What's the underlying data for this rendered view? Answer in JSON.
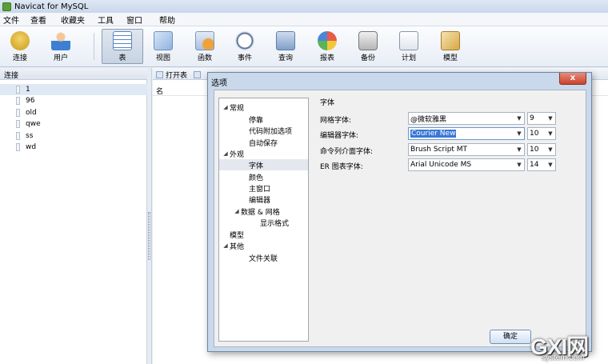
{
  "window": {
    "title": "Navicat for MySQL"
  },
  "menubar": [
    "文件",
    "查看",
    "收藏夹",
    "工具",
    "窗口",
    "帮助"
  ],
  "toolbar": [
    {
      "label": "连接",
      "icon": "connection-icon"
    },
    {
      "label": "用户",
      "icon": "user-icon"
    },
    {
      "label": "表",
      "icon": "table-icon"
    },
    {
      "label": "视图",
      "icon": "view-icon"
    },
    {
      "label": "函数",
      "icon": "function-icon"
    },
    {
      "label": "事件",
      "icon": "event-icon"
    },
    {
      "label": "查询",
      "icon": "query-icon"
    },
    {
      "label": "报表",
      "icon": "report-icon"
    },
    {
      "label": "备份",
      "icon": "backup-icon"
    },
    {
      "label": "计划",
      "icon": "schedule-icon"
    },
    {
      "label": "模型",
      "icon": "model-icon"
    }
  ],
  "left": {
    "header": "连接",
    "databases": [
      "1",
      "96",
      "old",
      "qwe",
      "ss",
      "wd"
    ],
    "selected": "1"
  },
  "object_toolbar": {
    "open_table": "打开表"
  },
  "object_list": {
    "column_name": "名"
  },
  "dialog": {
    "title": "选项",
    "close": "x",
    "tree": [
      {
        "label": "常规",
        "level": 0,
        "expanded": true
      },
      {
        "label": "停靠",
        "level": 1
      },
      {
        "label": "代码附加选项",
        "level": 1
      },
      {
        "label": "自动保存",
        "level": 1
      },
      {
        "label": "外观",
        "level": 0,
        "expanded": true
      },
      {
        "label": "字体",
        "level": 1,
        "selected": true
      },
      {
        "label": "颜色",
        "level": 1
      },
      {
        "label": "主窗口",
        "level": 1
      },
      {
        "label": "编辑器",
        "level": 1
      },
      {
        "label": "数据 & 网格",
        "level": 1,
        "expanded": true
      },
      {
        "label": "显示格式",
        "level": 2
      },
      {
        "label": "模型",
        "level": 0
      },
      {
        "label": "其他",
        "level": 0,
        "expanded": true
      },
      {
        "label": "文件关联",
        "level": 1
      }
    ],
    "section_title": "字体",
    "font_rows": [
      {
        "label": "网格字体:",
        "font": "@微软雅黑",
        "size": "9"
      },
      {
        "label": "编辑器字体:",
        "font": "Courier New",
        "size": "10"
      },
      {
        "label": "命令列介面字体:",
        "font": "Brush Script MT",
        "size": "10"
      },
      {
        "label": "ER 图表字体:",
        "font": "Arial Unicode MS",
        "size": "14"
      }
    ],
    "ok": "确定"
  },
  "watermark": {
    "main": "GXI网",
    "sub": "system.com"
  },
  "colors": {
    "accent": "#3a78d6",
    "close": "#c9432d",
    "dialog_frame": "#c9d8ea"
  }
}
